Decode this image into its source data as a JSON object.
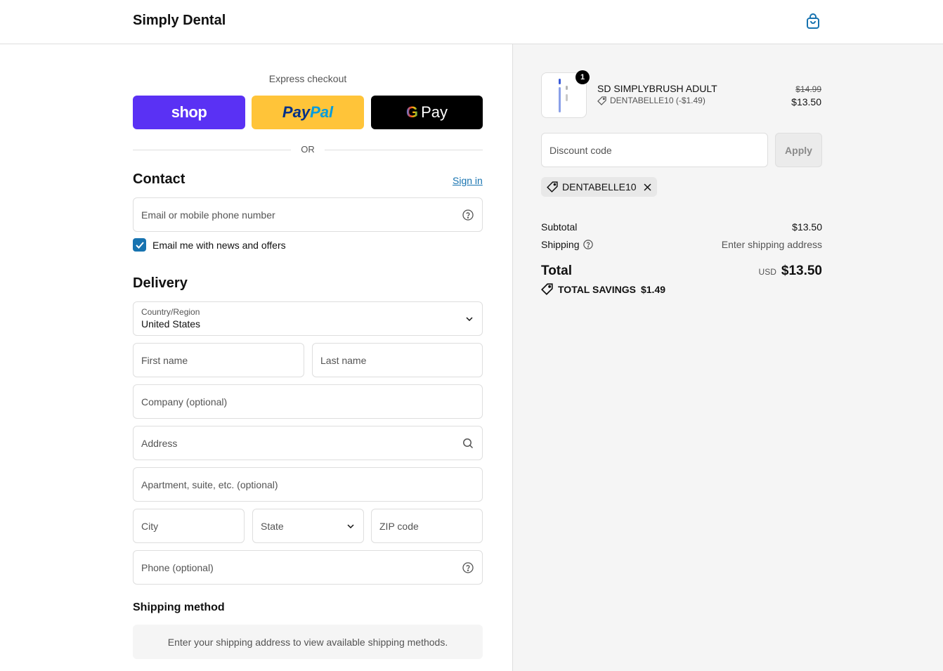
{
  "header": {
    "brand": "Simply Dental",
    "cart_icon": "shopping-bag-icon"
  },
  "express": {
    "title": "Express checkout",
    "shop_label": "shop",
    "paypal_part1": "Pay",
    "paypal_part2": "Pal",
    "gpay_g": "G",
    "gpay_label": "Pay",
    "or": "OR"
  },
  "contact": {
    "title": "Contact",
    "sign_in": "Sign in",
    "email_placeholder": "Email or mobile phone number",
    "news_label": "Email me with news and offers",
    "news_checked": true
  },
  "delivery": {
    "title": "Delivery",
    "country_label": "Country/Region",
    "country_value": "United States",
    "first_name": "First name",
    "last_name": "Last name",
    "company": "Company (optional)",
    "address": "Address",
    "apartment": "Apartment, suite, etc. (optional)",
    "city": "City",
    "state": "State",
    "zip": "ZIP code",
    "phone": "Phone (optional)"
  },
  "shipping_method": {
    "title": "Shipping method",
    "message": "Enter your shipping address to view available shipping methods."
  },
  "order": {
    "product_name": "SD SIMPLYBRUSH ADULT",
    "quantity": "1",
    "discount_line": "DENTABELLE10 (-$1.49)",
    "price_original": "$14.99",
    "price_final": "$13.50",
    "discount_placeholder": "Discount code",
    "apply_label": "Apply",
    "applied_code": "DENTABELLE10",
    "subtotal_label": "Subtotal",
    "subtotal_value": "$13.50",
    "shipping_label": "Shipping",
    "shipping_value": "Enter shipping address",
    "total_label": "Total",
    "currency": "USD",
    "total_value": "$13.50",
    "savings_label": "TOTAL SAVINGS",
    "savings_value": "$1.49"
  },
  "colors": {
    "accent": "#1773b0",
    "shop": "#5a31f4",
    "paypal": "#ffc439",
    "gpay": "#000000"
  }
}
